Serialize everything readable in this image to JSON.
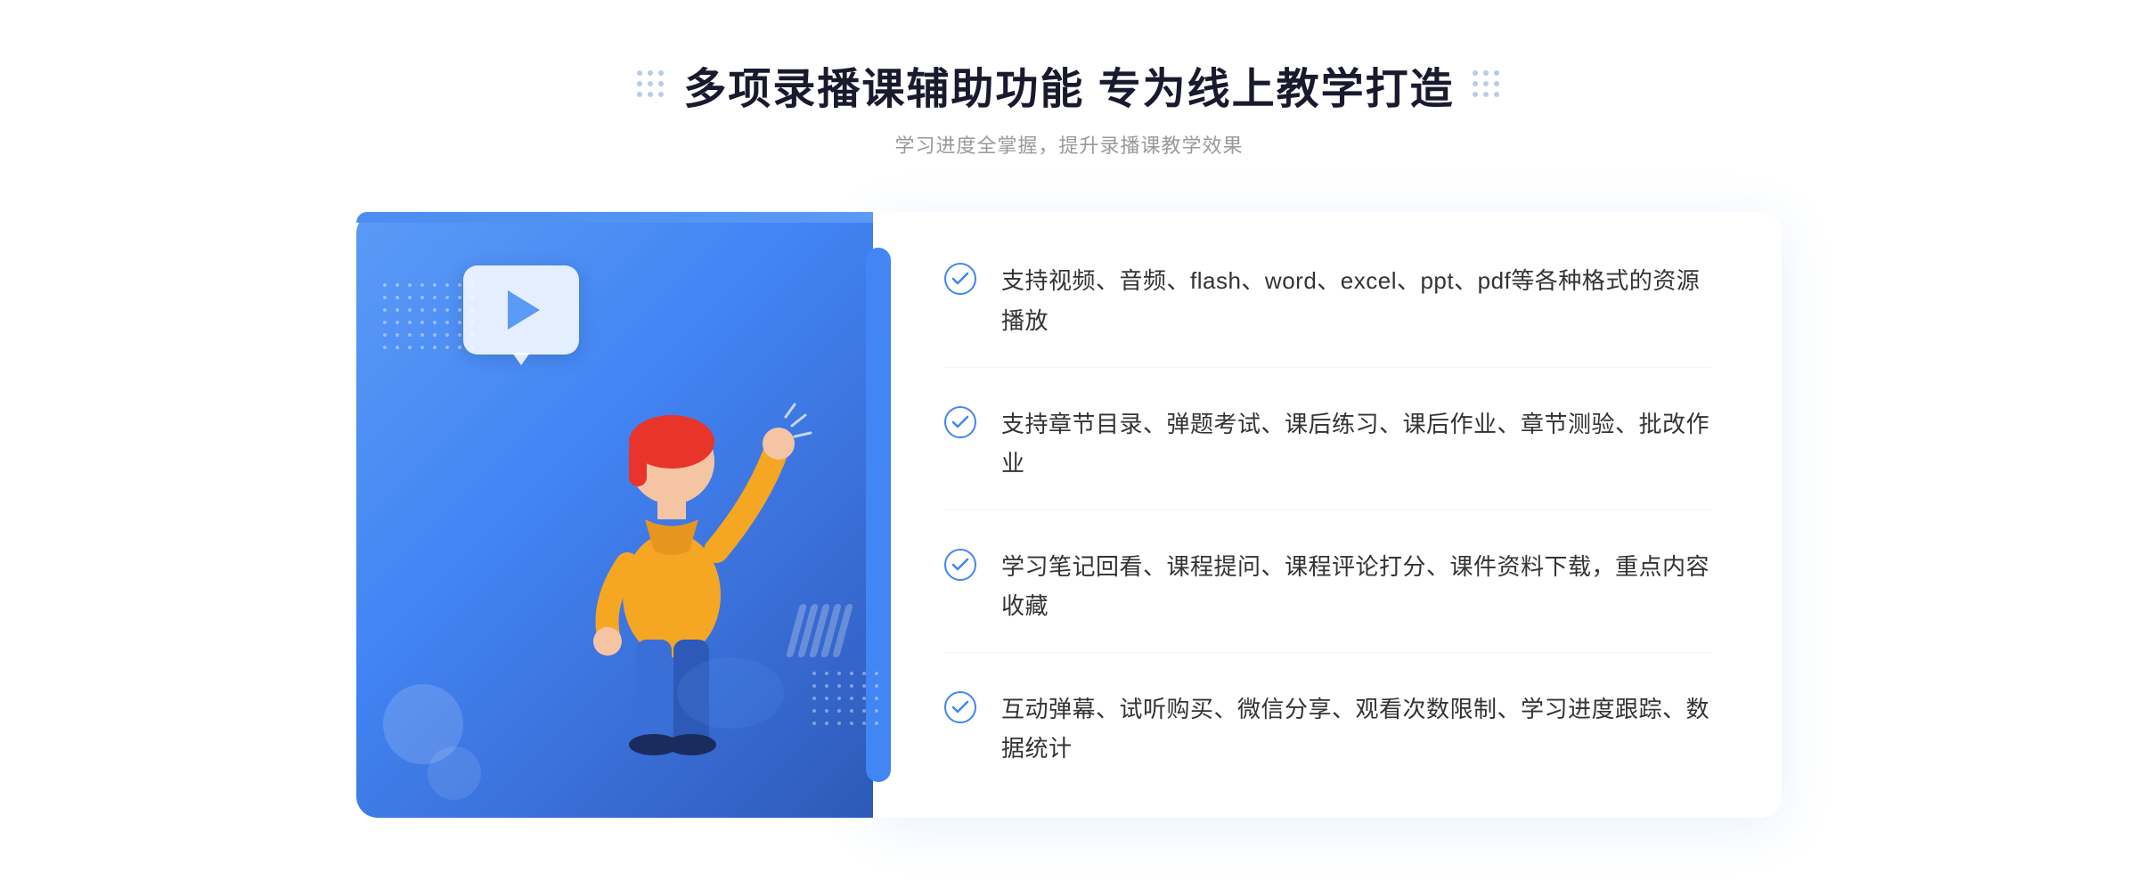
{
  "header": {
    "main_title": "多项录播课辅助功能 专为线上教学打造",
    "sub_title": "学习进度全掌握，提升录播课教学效果"
  },
  "features": [
    {
      "id": 1,
      "text": "支持视频、音频、flash、word、excel、ppt、pdf等各种格式的资源播放"
    },
    {
      "id": 2,
      "text": "支持章节目录、弹题考试、课后练习、课后作业、章节测验、批改作业"
    },
    {
      "id": 3,
      "text": "学习笔记回看、课程提问、课程评论打分、课件资料下载，重点内容收藏"
    },
    {
      "id": 4,
      "text": "互动弹幕、试听购买、微信分享、观看次数限制、学习进度跟踪、数据统计"
    }
  ],
  "colors": {
    "accent_blue": "#4285f4",
    "light_blue": "#5b9af5",
    "text_dark": "#1a1a2e",
    "text_gray": "#999999",
    "text_body": "#333333"
  },
  "icons": {
    "check": "check-circle",
    "play": "play-triangle",
    "chevron": "«"
  }
}
